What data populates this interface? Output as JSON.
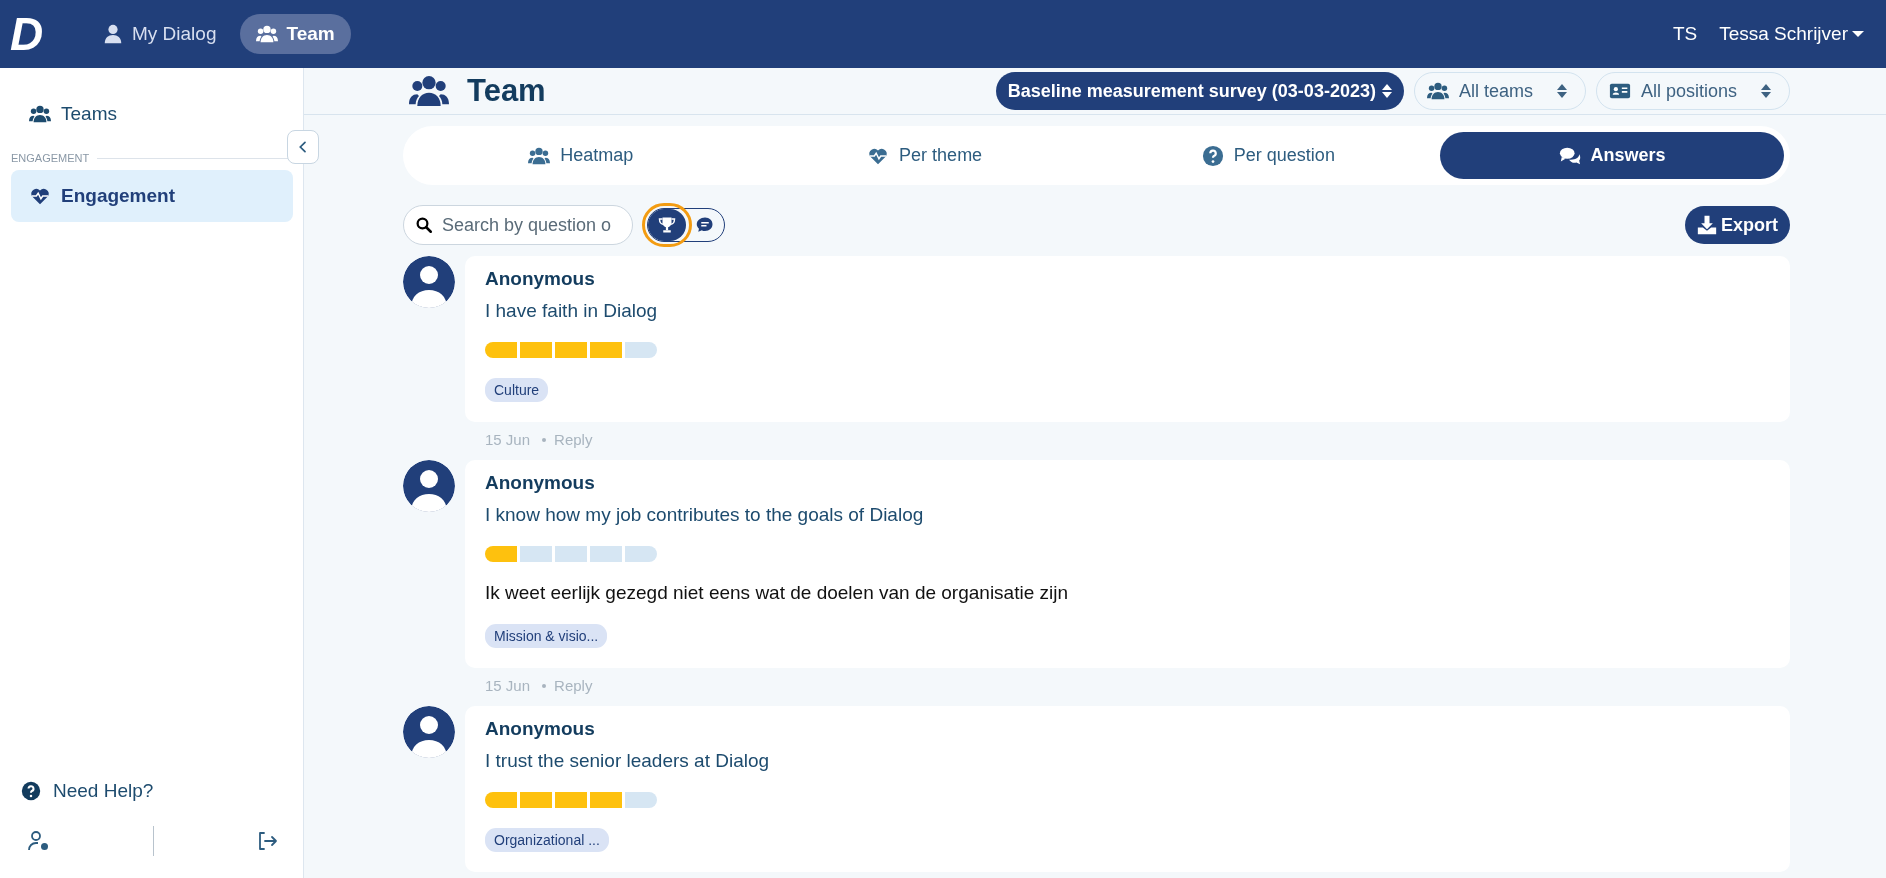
{
  "top_nav": {
    "logo": "D",
    "items": [
      {
        "label": "My Dialog",
        "kind": "person",
        "selected": false
      },
      {
        "label": "Team",
        "kind": "users",
        "selected": true
      }
    ],
    "user": {
      "initials": "TS",
      "name": "Tessa Schrijver"
    }
  },
  "sidebar": {
    "items": [
      {
        "label": "Teams",
        "kind": "users",
        "selected": false
      }
    ],
    "section": "ENGAGEMENT",
    "section_items": [
      {
        "label": "Engagement",
        "kind": "heart",
        "selected": true
      }
    ],
    "help": "Need Help?"
  },
  "header": {
    "title": "Team",
    "survey": "Baseline measurement survey (03-03-2023)",
    "teams": "All teams",
    "positions": "All positions"
  },
  "tabs": [
    {
      "label": "Heatmap",
      "kind": "users",
      "selected": false
    },
    {
      "label": "Per theme",
      "kind": "heart",
      "selected": false
    },
    {
      "label": "Per question",
      "kind": "question",
      "selected": false
    },
    {
      "label": "Answers",
      "kind": "chat",
      "selected": true
    }
  ],
  "search": {
    "placeholder": "Search by question o"
  },
  "view_toggle": [
    {
      "kind": "trophy",
      "selected": true
    },
    {
      "kind": "chat",
      "selected": false
    }
  ],
  "export": "Export",
  "answers": [
    {
      "author": "Anonymous",
      "question": "I have faith in Dialog",
      "stars": 4,
      "tag": "Culture",
      "date": "15 Jun",
      "reply": "Reply"
    },
    {
      "author": "Anonymous",
      "question": "I know how my job contributes to the goals of Dialog",
      "stars": 1,
      "comment": "Ik weet eerlijk gezegd niet eens wat de doelen van de organisatie zijn",
      "tag": "Mission & visio...",
      "date": "15 Jun",
      "reply": "Reply"
    },
    {
      "author": "Anonymous",
      "question": "I trust the senior leaders at Dialog",
      "stars": 4,
      "tag": "Organizational ..."
    }
  ]
}
